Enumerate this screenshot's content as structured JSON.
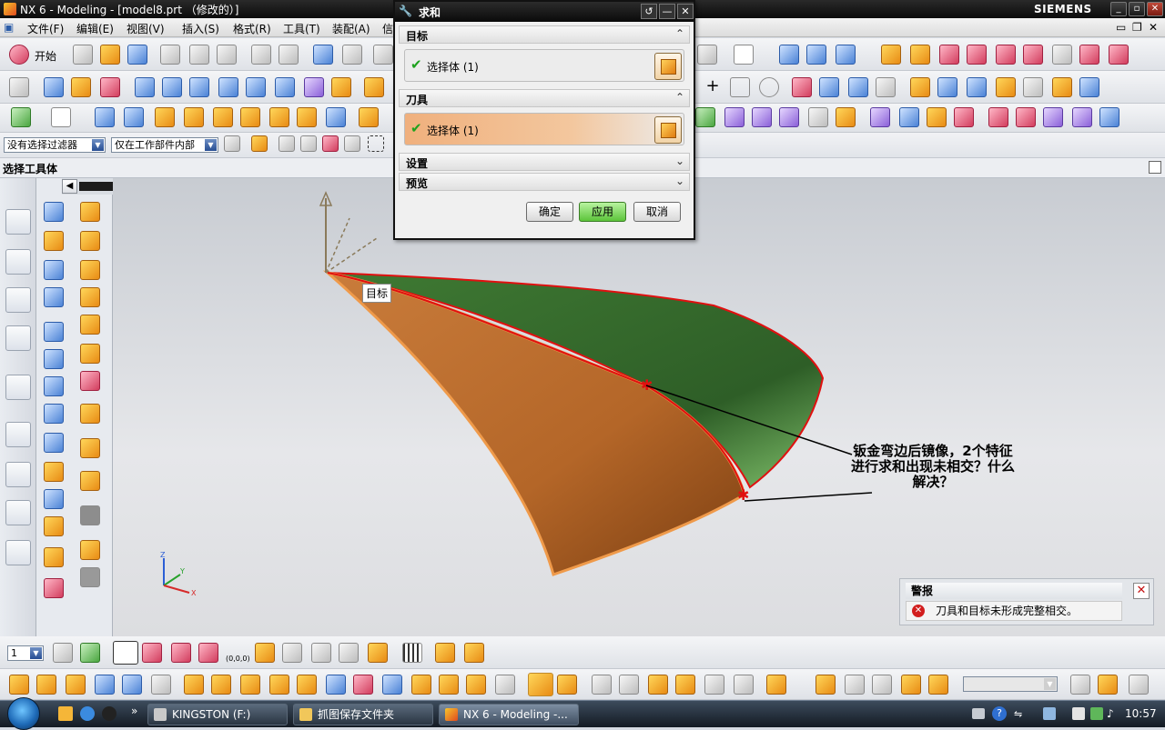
{
  "window": {
    "title": "NX 6 - Modeling - [model8.prt （修改的）]",
    "brand": "SIEMENS"
  },
  "menubar": {
    "items": [
      "文件(F)",
      "编辑(E)",
      "视图(V)",
      "插入(S)",
      "格式(R)",
      "工具(T)",
      "装配(A)",
      "信"
    ],
    "start_label": "开始"
  },
  "filter": {
    "type_filter": "没有选择过滤器",
    "scope_filter": "仅在工作部件内部"
  },
  "panel_label": "选择工具体",
  "dialog": {
    "title": "求和",
    "sections": [
      {
        "label": "目标",
        "selection": "选择体 (1)",
        "expanded": true
      },
      {
        "label": "刀具",
        "selection": "选择体 (1)",
        "expanded": true
      },
      {
        "label": "设置",
        "expanded": false
      },
      {
        "label": "预览",
        "expanded": false
      }
    ],
    "buttons": {
      "ok": "确定",
      "apply": "应用",
      "cancel": "取消"
    }
  },
  "viewport": {
    "tooltip": "目标",
    "annotation_lines": [
      "钣金弯边后镜像，2个特征",
      "进行求和出现未相交？什么",
      "解决？"
    ],
    "triad_labels": {
      "x": "X",
      "y": "Y",
      "z": "Z"
    },
    "wcs_label": "(0,0,0)"
  },
  "warning": {
    "title": "警报",
    "message": "刀具和目标未形成完整相交。"
  },
  "bottom": {
    "layer_value": "1"
  },
  "taskbar": {
    "tasks": [
      {
        "label": "KINGSTON (F:)",
        "active": false
      },
      {
        "label": "抓图保存文件夹",
        "active": false
      },
      {
        "label": "NX 6 - Modeling -...",
        "active": true
      }
    ],
    "clock": "10:57"
  },
  "colors": {
    "apply_button": "#7ed957",
    "target_body": "#4f8a3d",
    "tool_body": "#c7722f",
    "edge_highlight": "#e01010"
  }
}
